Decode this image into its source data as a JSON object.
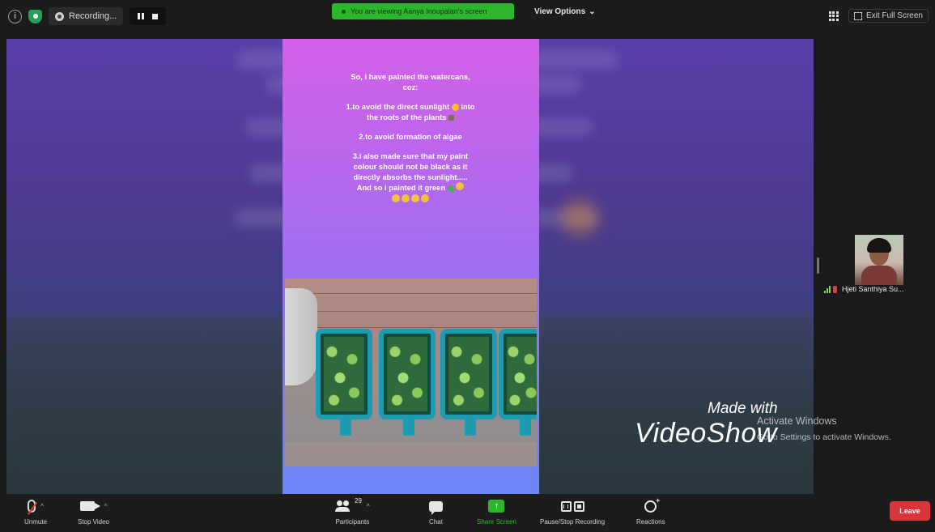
{
  "topbar": {
    "recording_label": "Recording...",
    "viewing_banner": "You are viewing Aanya Inoupalan's screen",
    "view_options_label": "View Options",
    "exit_fullscreen_label": "Exit Full Screen"
  },
  "story": {
    "intro": "So, i have painted the watercans, coz:",
    "point1": "1.to avoid the direct sunlight",
    "point1b": "into the roots of the plants",
    "point2": "2.to avoid formation of algae",
    "point3": "3.i also made sure that my paint colour should not be black as it directly absorbs the sunlight..... And so i painted it green"
  },
  "watermark": {
    "made_with": "Made with",
    "brand": "VideoShow"
  },
  "activate_windows": {
    "title": "Activate Windows",
    "subtitle": "Go to Settings to activate Windows."
  },
  "gallery": {
    "participant_name": "Hjeti Santhiya Su..."
  },
  "toolbar": {
    "unmute_label": "Unmute",
    "stop_video_label": "Stop Video",
    "participants_label": "Participants",
    "participants_count": "29",
    "chat_label": "Chat",
    "share_screen_label": "Share Screen",
    "pause_recording_label": "Pause/Stop Recording",
    "reactions_label": "Reactions",
    "leave_label": "Leave"
  },
  "colors": {
    "share_green": "#2eb52e",
    "leave_red": "#d9343a",
    "toolbar_bg": "#1c1c1c"
  }
}
